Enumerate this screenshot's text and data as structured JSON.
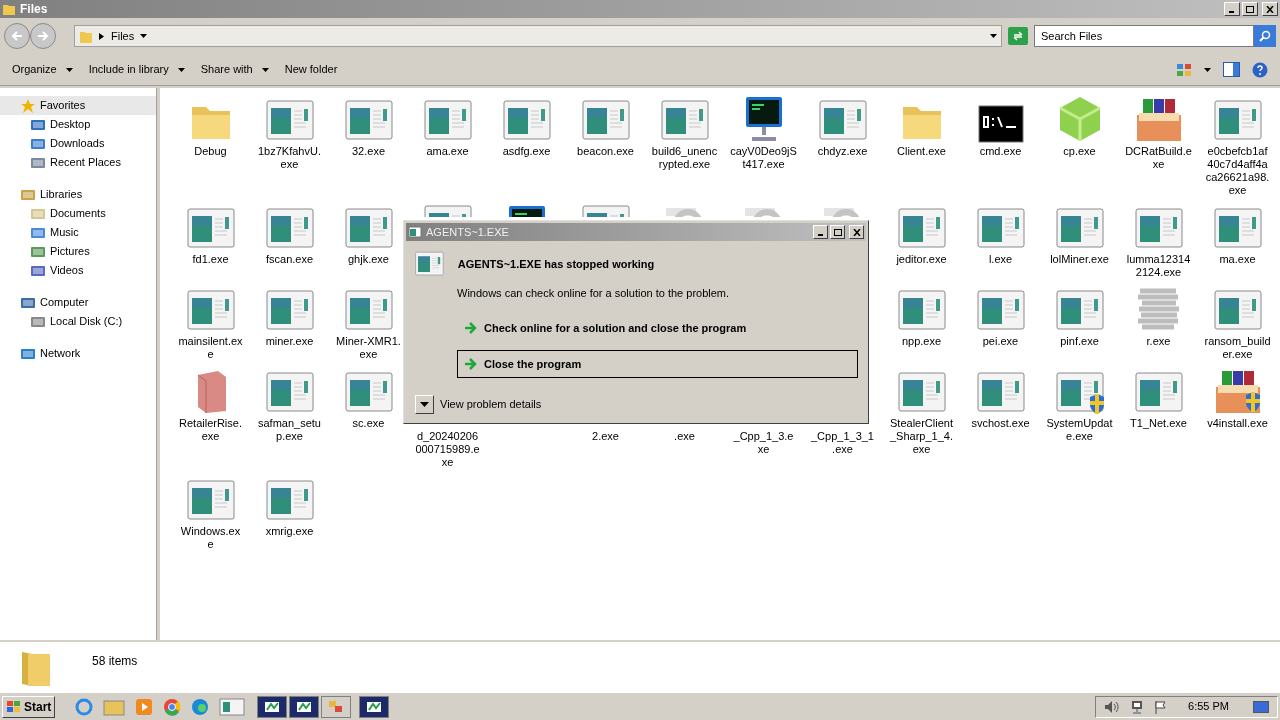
{
  "window": {
    "title": "Files"
  },
  "address": {
    "path": "Files",
    "search_placeholder": "Search Files"
  },
  "toolbar": {
    "menus": [
      {
        "label": "Organize",
        "dropdown": true
      },
      {
        "label": "Include in library",
        "dropdown": true
      },
      {
        "label": "Share with",
        "dropdown": true
      },
      {
        "label": "New folder",
        "dropdown": false
      }
    ]
  },
  "sidebar": {
    "groups": [
      {
        "label": "Favorites",
        "kind": "star",
        "selected": true,
        "children": [
          {
            "label": "Desktop",
            "kind": "desktop",
            "selected": false
          },
          {
            "label": "Downloads",
            "kind": "downloads",
            "selected": false
          },
          {
            "label": "Recent Places",
            "kind": "recent",
            "selected": false
          }
        ]
      },
      {
        "label": "Libraries",
        "kind": "library",
        "selected": false,
        "children": [
          {
            "label": "Documents",
            "kind": "documents",
            "selected": false
          },
          {
            "label": "Music",
            "kind": "music",
            "selected": false
          },
          {
            "label": "Pictures",
            "kind": "pictures",
            "selected": false
          },
          {
            "label": "Videos",
            "kind": "videos",
            "selected": false
          }
        ]
      },
      {
        "label": "Computer",
        "kind": "computer",
        "selected": false,
        "children": [
          {
            "label": "Local Disk (C:)",
            "kind": "disk",
            "selected": false
          }
        ]
      },
      {
        "label": "Network",
        "kind": "network",
        "selected": false
      }
    ]
  },
  "files": [
    {
      "kind": "folder",
      "lines": [
        "Debug"
      ]
    },
    {
      "kind": "app",
      "lines": [
        "1bz7KfahvU.",
        "exe"
      ]
    },
    {
      "kind": "app",
      "lines": [
        "32.exe"
      ]
    },
    {
      "kind": "app",
      "lines": [
        "ama.exe"
      ]
    },
    {
      "kind": "app",
      "lines": [
        "asdfg.exe"
      ]
    },
    {
      "kind": "app",
      "lines": [
        "beacon.exe"
      ]
    },
    {
      "kind": "app",
      "lines": [
        "build6_unenc",
        "rypted.exe"
      ]
    },
    {
      "kind": "monitor",
      "lines": [
        "cayV0Deo9jS",
        "t417.exe"
      ]
    },
    {
      "kind": "app",
      "lines": [
        "chdyz.exe"
      ]
    },
    {
      "kind": "folder",
      "lines": [
        "Client.exe"
      ]
    },
    {
      "kind": "cmd",
      "lines": [
        "cmd.exe"
      ]
    },
    {
      "kind": "cube",
      "lines": [
        "cp.exe"
      ]
    },
    {
      "kind": "archive",
      "lines": [
        "DCRatBuild.e",
        "xe"
      ]
    },
    {
      "kind": "app",
      "lines": [
        "e0cbefcb1af",
        "40c7d4aff4a",
        "ca26621a98.",
        "exe"
      ]
    },
    {
      "kind": "app",
      "lines": [
        "fd1.exe"
      ]
    },
    {
      "kind": "app",
      "lines": [
        "fscan.exe"
      ]
    },
    {
      "kind": "app",
      "lines": [
        "ghjk.exe"
      ]
    },
    {
      "kind": "app",
      "covered": true
    },
    {
      "kind": "monitor",
      "covered": true
    },
    {
      "kind": "app",
      "covered": true
    },
    {
      "kind": "ring",
      "covered": true
    },
    {
      "kind": "ring",
      "covered": true
    },
    {
      "kind": "ring",
      "covered": true
    },
    {
      "kind": "app",
      "lines": [
        "jeditor.exe"
      ]
    },
    {
      "kind": "app",
      "lines": [
        "l.exe"
      ]
    },
    {
      "kind": "app",
      "lines": [
        "lolMiner.exe"
      ]
    },
    {
      "kind": "app",
      "lines": [
        "lumma12314",
        "2124.exe"
      ]
    },
    {
      "kind": "app",
      "lines": [
        "ma.exe"
      ]
    },
    {
      "kind": "app",
      "lines": [
        "mainsilent.ex",
        "e"
      ]
    },
    {
      "kind": "app",
      "lines": [
        "miner.exe"
      ]
    },
    {
      "kind": "app",
      "lines": [
        "Miner-XMR1.",
        "exe"
      ]
    },
    {
      "kind": "empty"
    },
    {
      "kind": "empty"
    },
    {
      "kind": "empty"
    },
    {
      "kind": "empty"
    },
    {
      "kind": "empty"
    },
    {
      "kind": "empty"
    },
    {
      "kind": "app",
      "lines": [
        "npp.exe"
      ]
    },
    {
      "kind": "app",
      "lines": [
        "pei.exe"
      ]
    },
    {
      "kind": "app",
      "lines": [
        "pinf.exe"
      ]
    },
    {
      "kind": "scribble",
      "lines": [
        "r.exe"
      ]
    },
    {
      "kind": "app",
      "lines": [
        "ransom_build",
        "er.exe"
      ]
    },
    {
      "kind": "package",
      "lines": [
        "RetailerRise.",
        "exe"
      ]
    },
    {
      "kind": "app",
      "lines": [
        "safman_setu",
        "p.exe"
      ]
    },
    {
      "kind": "app",
      "lines": [
        "sc.exe"
      ]
    },
    {
      "kind": "hidden",
      "covered": true,
      "lines": [
        "d_20240206",
        "000715989.e",
        "xe"
      ]
    },
    {
      "kind": "empty"
    },
    {
      "kind": "hidden",
      "covered": true,
      "lines": [
        "2.exe"
      ]
    },
    {
      "kind": "hidden",
      "covered": true,
      "lines": [
        ".exe"
      ]
    },
    {
      "kind": "hidden",
      "covered": true,
      "lines": [
        "_Cpp_1_3.e",
        "xe"
      ]
    },
    {
      "kind": "hidden",
      "covered": true,
      "lines": [
        "_Cpp_1_3_1",
        ".exe"
      ]
    },
    {
      "kind": "app",
      "lines": [
        "StealerClient",
        "_Sharp_1_4.",
        "exe"
      ]
    },
    {
      "kind": "app",
      "lines": [
        "svchost.exe"
      ]
    },
    {
      "kind": "app-shield",
      "lines": [
        "SystemUpdat",
        "e.exe"
      ]
    },
    {
      "kind": "app",
      "lines": [
        "T1_Net.exe"
      ]
    },
    {
      "kind": "archive-shield",
      "lines": [
        "v4install.exe"
      ]
    },
    {
      "kind": "app",
      "lines": [
        "Windows.ex",
        "e"
      ]
    },
    {
      "kind": "app",
      "lines": [
        "xmrig.exe"
      ]
    }
  ],
  "dialog": {
    "title": "AGENTS~1.EXE",
    "heading": "AGENTS~1.EXE has stopped working",
    "message": "Windows can check online for a solution to the problem.",
    "options": [
      {
        "label": "Check online for a solution and close the program",
        "selected": false
      },
      {
        "label": "Close the program",
        "selected": true
      }
    ],
    "details": "View problem details"
  },
  "status_bar": {
    "count": "58 items"
  },
  "taskbar": {
    "start": "Start",
    "clock": "6:55 PM"
  }
}
